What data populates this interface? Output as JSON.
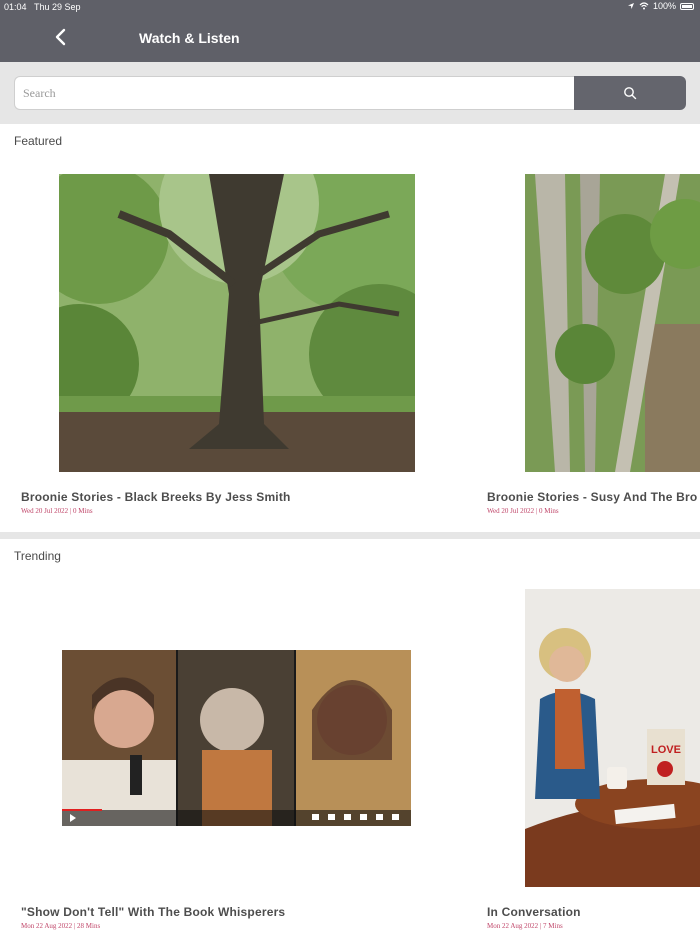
{
  "status_bar": {
    "time": "01:04",
    "date": "Thu 29 Sep",
    "battery": "100%"
  },
  "header": {
    "title": "Watch & Listen",
    "back_icon": "chevron-left-icon"
  },
  "search": {
    "placeholder": "Search",
    "value": "",
    "icon": "search-icon"
  },
  "sections": [
    {
      "title": "Featured",
      "items": [
        {
          "title": "Broonie Stories - Black Breeks By Jess Smith",
          "meta": "Wed 20 Jul 2022 | 0 Mins",
          "thumb": "tree-photo"
        },
        {
          "title": "Broonie Stories - Susy And The Bro",
          "meta": "Wed 20 Jul 2022 | 0 Mins",
          "thumb": "woodland-path-photo"
        }
      ]
    },
    {
      "title": "Trending",
      "items": [
        {
          "title": "\"Show Don't Tell\" With The Book Whisperers",
          "meta": "Mon 22 Aug 2022 | 28 Mins",
          "thumb": "video-call-screenshot"
        },
        {
          "title": "In Conversation",
          "meta": "Mon 22 Aug 2022 | 7 Mins",
          "thumb": "interview-photo"
        }
      ]
    }
  ]
}
